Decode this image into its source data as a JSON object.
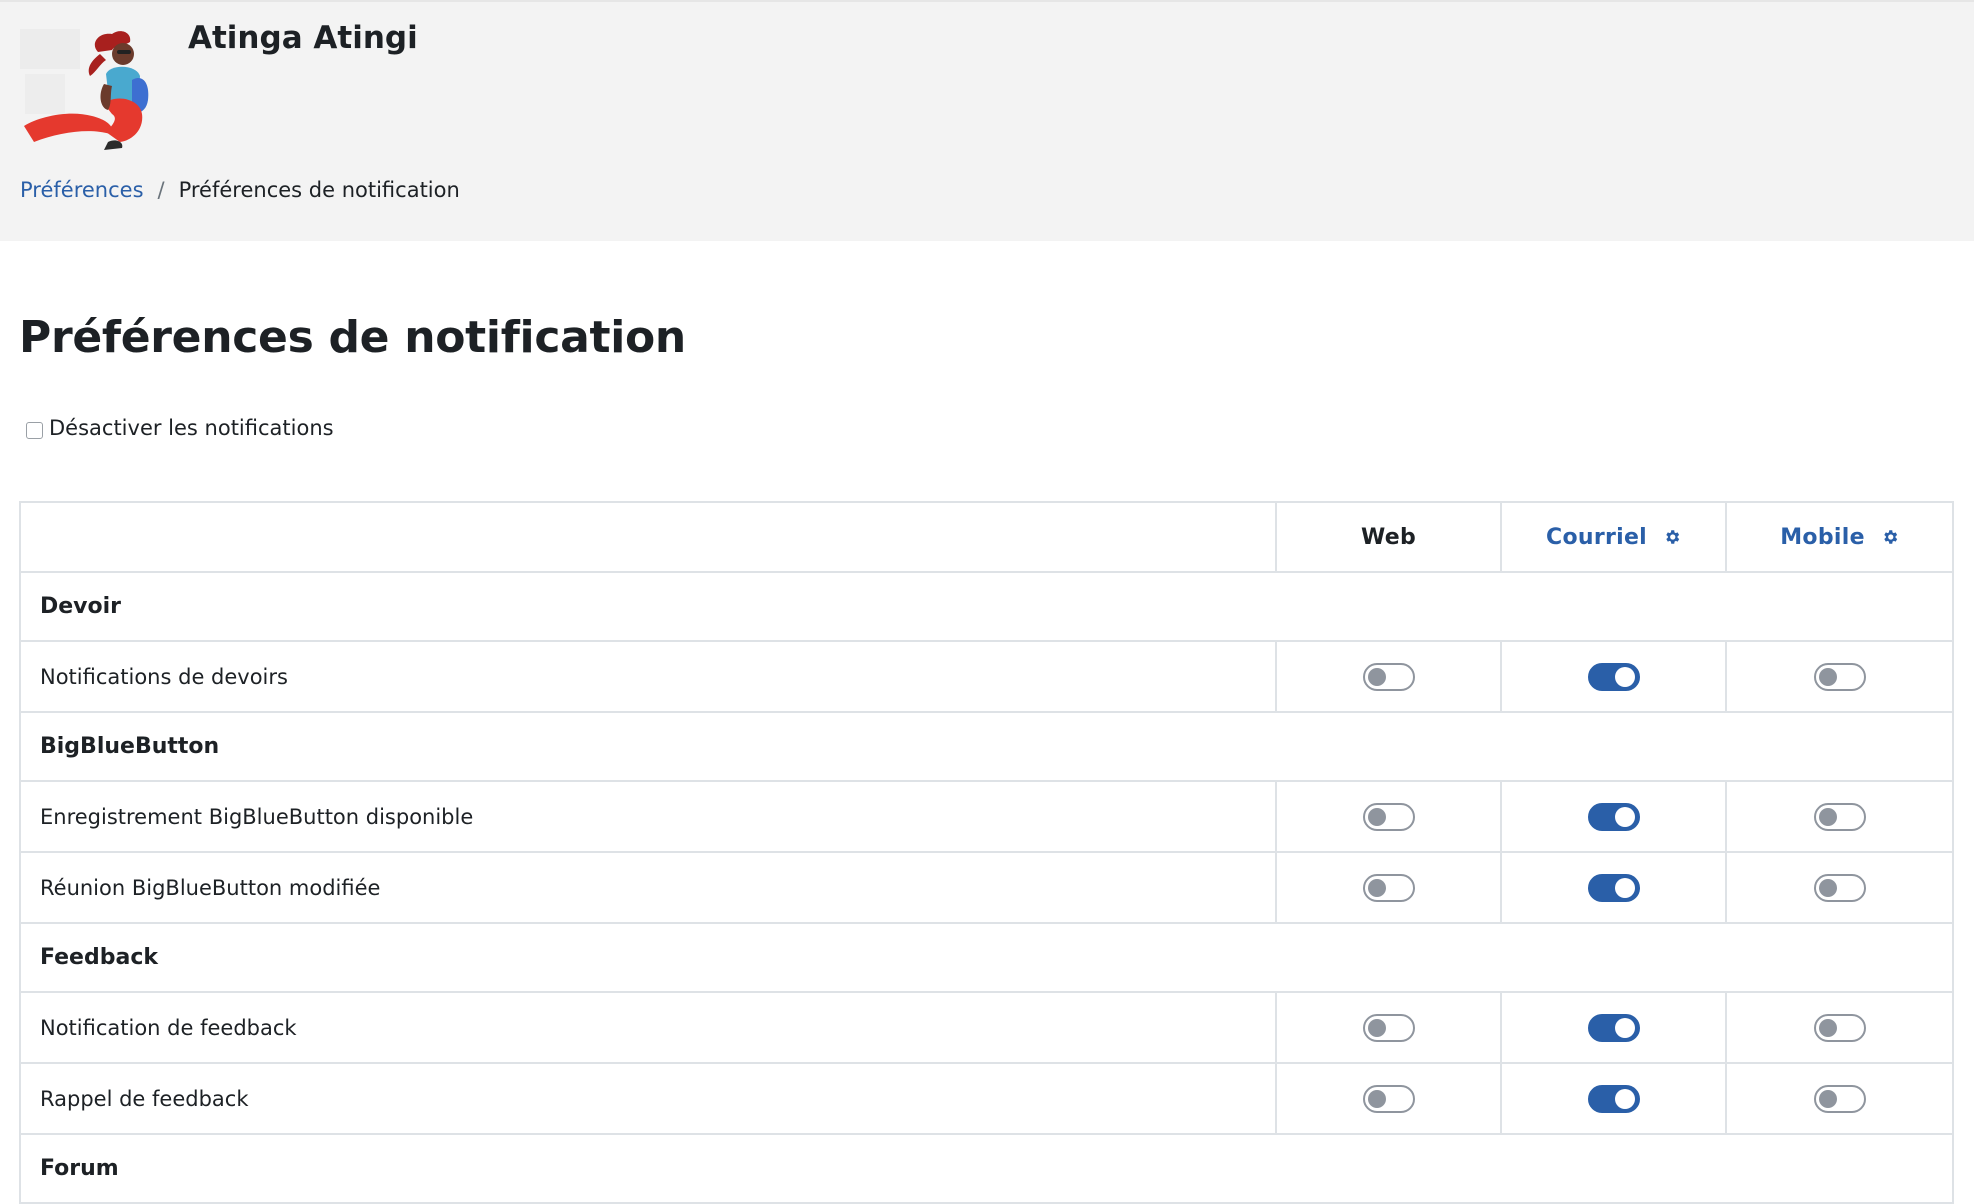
{
  "header": {
    "user_name": "Atinga Atingi",
    "breadcrumb": {
      "parent": "Préférences",
      "separator": "/",
      "current": "Préférences de notification"
    }
  },
  "page": {
    "title": "Préférences de notification",
    "disable_label": "Désactiver les notifications",
    "disable_checked": false
  },
  "table": {
    "columns": {
      "web": "Web",
      "email": "Courriel",
      "mobile": "Mobile"
    },
    "groups": [
      {
        "name": "Devoir",
        "items": [
          {
            "label": "Notifications de devoirs",
            "web": false,
            "email": true,
            "mobile": false
          }
        ]
      },
      {
        "name": "BigBlueButton",
        "items": [
          {
            "label": "Enregistrement BigBlueButton disponible",
            "web": false,
            "email": true,
            "mobile": false
          },
          {
            "label": "Réunion BigBlueButton modifiée",
            "web": false,
            "email": true,
            "mobile": false
          }
        ]
      },
      {
        "name": "Feedback",
        "items": [
          {
            "label": "Notification de feedback",
            "web": false,
            "email": true,
            "mobile": false
          },
          {
            "label": "Rappel de feedback",
            "web": false,
            "email": true,
            "mobile": false
          }
        ]
      },
      {
        "name": "Forum",
        "items": []
      }
    ]
  },
  "colors": {
    "accent": "#2a5fa8",
    "header_bg": "#f3f3f3",
    "toggle_off": "#8f959e"
  },
  "icons": {
    "settings": "gear-icon"
  }
}
